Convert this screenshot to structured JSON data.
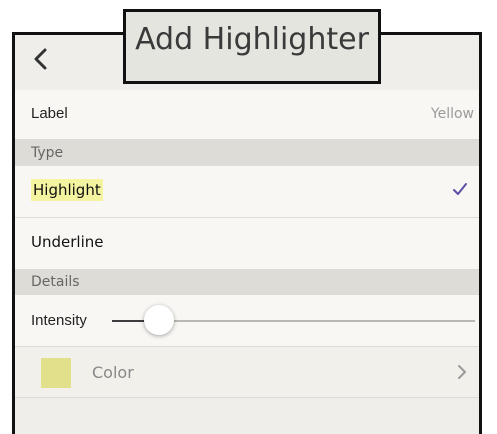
{
  "header": {
    "title": "Add Highlighter",
    "back_icon": "chevron-left-icon"
  },
  "label_row": {
    "label": "Label",
    "value": "Yellow"
  },
  "type_section": {
    "header": "Type",
    "options": [
      {
        "label": "Highlight",
        "selected": true
      },
      {
        "label": "Underline",
        "selected": false
      }
    ]
  },
  "details_section": {
    "header": "Details",
    "intensity": {
      "label": "Intensity",
      "value": 0.13
    },
    "color": {
      "label": "Color",
      "swatch": "#e3e08c",
      "chevron_icon": "chevron-right-icon"
    }
  },
  "colors": {
    "checkmark": "#5b4fa3",
    "highlight_mark": "#f4f3a0"
  }
}
